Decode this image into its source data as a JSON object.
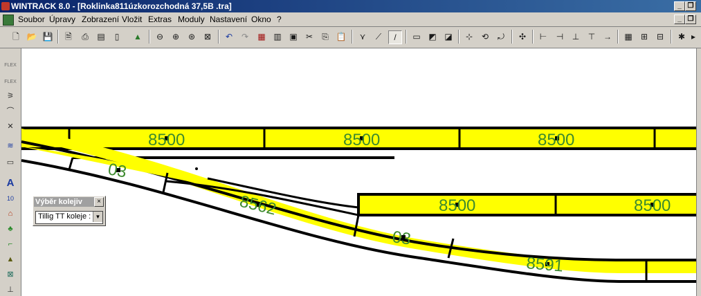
{
  "window": {
    "title": "WINTRACK 8.0 - [Roklinka811úzkorozchodná 37,5B .tra]"
  },
  "menu": [
    "Soubor",
    "Úpravy",
    "Zobrazení",
    "Vložit",
    "Extras",
    "Moduly",
    "Nastavení",
    "Okno",
    "?"
  ],
  "toolbar": {
    "buttons": [
      "new-file",
      "open-file",
      "save",
      "print-preview",
      "print",
      "print-setup",
      "page-setup",
      "landscape-view",
      "zoom-out",
      "zoom-in",
      "zoom-fit",
      "zoom-all",
      "undo",
      "redo",
      "copy-doc",
      "duplicate",
      "mirror",
      "cut",
      "copy",
      "paste",
      "filter",
      "connect-track",
      "draw-line",
      "window-1",
      "window-2",
      "window-3",
      "align",
      "rotate",
      "rotate-180",
      "snap",
      "measure",
      "split",
      "join",
      "shorten",
      "move",
      "grid",
      "clean",
      "settings"
    ],
    "active": "draw-line"
  },
  "left_toolbar": {
    "tools": [
      {
        "name": "flex-track-tool",
        "glyph": "FLEX"
      },
      {
        "name": "flex-track-2-tool",
        "glyph": "FLEX"
      },
      {
        "name": "turnout-tool",
        "glyph": "⚞"
      },
      {
        "name": "curve-tool",
        "glyph": "⌒"
      },
      {
        "name": "crossing-tool",
        "glyph": "✕"
      },
      {
        "name": "terrain-tool",
        "glyph": "≋"
      },
      {
        "name": "platform-tool",
        "glyph": "▭"
      },
      {
        "name": "text-tool",
        "glyph": "A"
      },
      {
        "name": "number-tool",
        "glyph": "10"
      },
      {
        "name": "building-tool",
        "glyph": "⌂"
      },
      {
        "name": "tree-tool",
        "glyph": "♣"
      },
      {
        "name": "stairs-tool",
        "glyph": "⌐"
      },
      {
        "name": "landscape-tool",
        "glyph": "▲"
      },
      {
        "name": "chart-tool",
        "glyph": "⊠"
      }
    ]
  },
  "track_labels": [
    "8500",
    "8500",
    "8500",
    "03",
    "8562",
    "8500",
    "8500",
    "03",
    "8591"
  ],
  "panel": {
    "title": "Výběr kolejiv",
    "close": "×",
    "select_value": "Tillig TT koleje :",
    "arrow": "▼"
  },
  "colors": {
    "track_fill": "#ffff00",
    "track_outline": "#000000",
    "label": "#3d8a2e"
  }
}
